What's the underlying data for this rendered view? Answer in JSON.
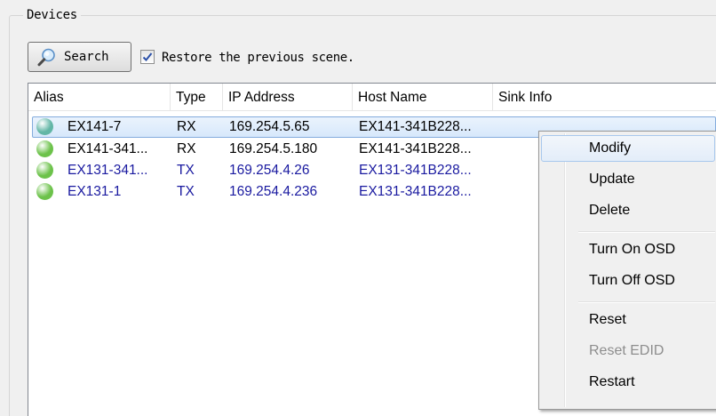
{
  "group": {
    "title": "Devices"
  },
  "toolbar": {
    "search_label": "Search",
    "restore_checked": true,
    "restore_label": "Restore the previous scene."
  },
  "columns": [
    "Alias",
    "Type",
    "IP Address",
    "Host Name",
    "Sink Info"
  ],
  "devices": [
    {
      "alias": "EX141-7",
      "type": "RX",
      "ip": "169.254.5.65",
      "host": "EX141-341B228...",
      "sink": "",
      "status_color": "#62b6a6",
      "text_color": "#000000",
      "selected": true
    },
    {
      "alias": "EX141-341...",
      "type": "RX",
      "ip": "169.254.5.180",
      "host": "EX141-341B228...",
      "sink": "",
      "status_color": "#6cc24a",
      "text_color": "#000000",
      "selected": false
    },
    {
      "alias": "EX131-341...",
      "type": "TX",
      "ip": "169.254.4.26",
      "host": "EX131-341B228...",
      "sink": "",
      "status_color": "#6cc24a",
      "text_color": "#1a1aa0",
      "selected": false
    },
    {
      "alias": "EX131-1",
      "type": "TX",
      "ip": "169.254.4.236",
      "host": "EX131-341B228...",
      "sink": "",
      "status_color": "#6cc24a",
      "text_color": "#1a1aa0",
      "selected": false
    }
  ],
  "context_menu": {
    "items": [
      {
        "label": "Modify",
        "state": "hover"
      },
      {
        "label": "Update",
        "state": "normal"
      },
      {
        "label": "Delete",
        "state": "normal"
      },
      {
        "separator": true
      },
      {
        "label": "Turn On OSD",
        "state": "normal"
      },
      {
        "label": "Turn Off OSD",
        "state": "normal"
      },
      {
        "separator": true
      },
      {
        "label": "Reset",
        "state": "normal"
      },
      {
        "label": "Reset EDID",
        "state": "disabled"
      },
      {
        "label": "Restart",
        "state": "normal"
      }
    ]
  }
}
